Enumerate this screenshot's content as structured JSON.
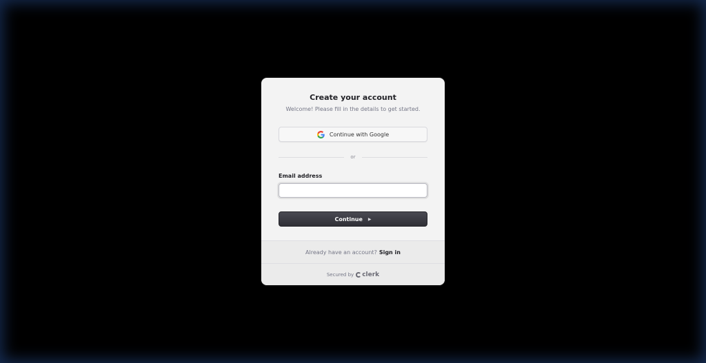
{
  "card": {
    "title": "Create your account",
    "subtitle": "Welcome! Please fill in the details to get started."
  },
  "google": {
    "label": "Continue with Google",
    "icon": "google-icon"
  },
  "divider": {
    "label": "or"
  },
  "email": {
    "label": "Email address",
    "value": "",
    "placeholder": ""
  },
  "continue": {
    "label": "Continue",
    "icon": "caret-right-icon"
  },
  "footer": {
    "prompt": "Already have an account?",
    "signin_label": "Sign in",
    "secured_by": "Secured by",
    "brand": "clerk"
  },
  "colors": {
    "background": "#000000",
    "card": "#f3f3f3",
    "button_dark": "#2f2f36",
    "text_primary": "#212126",
    "text_muted": "#747686"
  }
}
